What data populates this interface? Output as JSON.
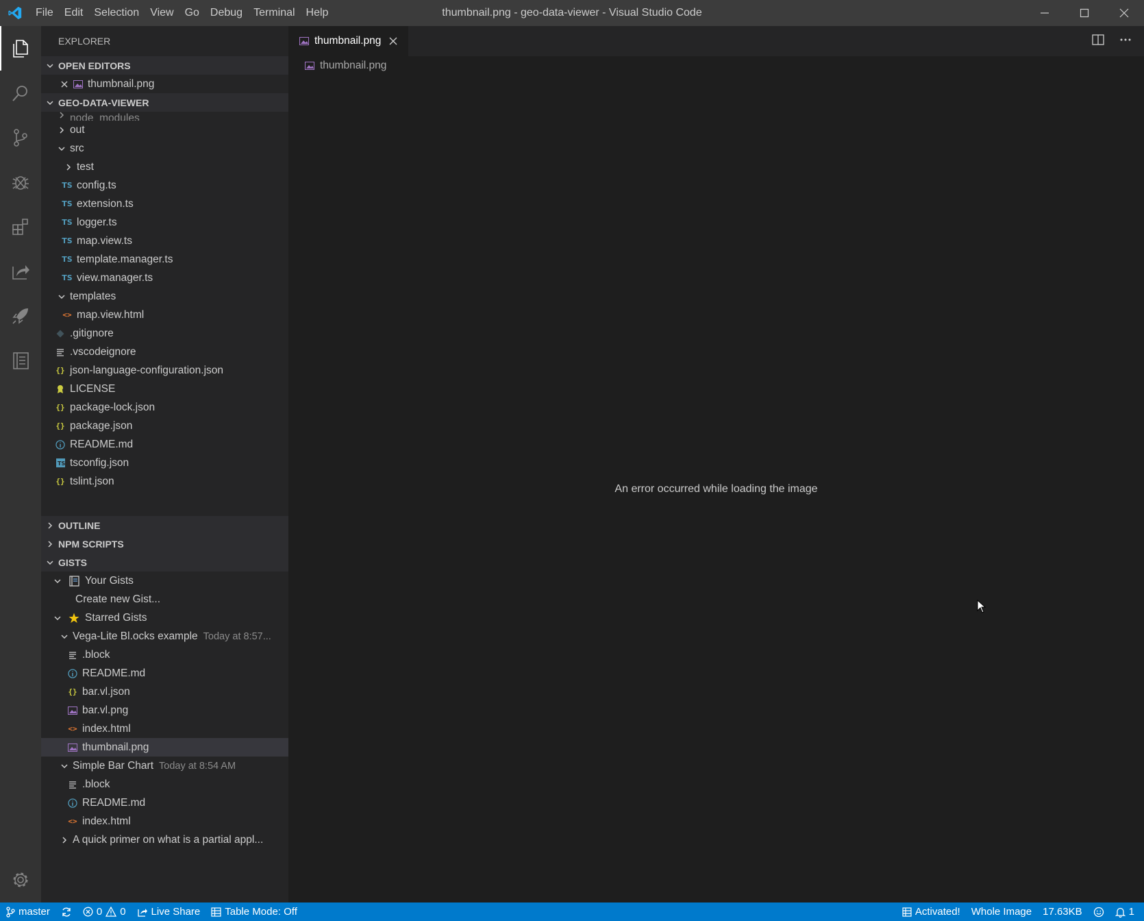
{
  "titlebar": {
    "menu": [
      "File",
      "Edit",
      "Selection",
      "View",
      "Go",
      "Debug",
      "Terminal",
      "Help"
    ],
    "window_title": "thumbnail.png - geo-data-viewer - Visual Studio Code"
  },
  "sidebar": {
    "title": "EXPLORER",
    "open_editors": {
      "label": "OPEN EDITORS",
      "items": [
        {
          "name": "thumbnail.png"
        }
      ]
    },
    "project": {
      "label": "GEO-DATA-VIEWER",
      "partial_item": "node_modules",
      "items": [
        {
          "name": "out",
          "kind": "folder",
          "expanded": false
        },
        {
          "name": "src",
          "kind": "folder",
          "expanded": true
        },
        {
          "name": "test",
          "kind": "folder",
          "expanded": false
        },
        {
          "name": "config.ts",
          "icon": "TS"
        },
        {
          "name": "extension.ts",
          "icon": "TS"
        },
        {
          "name": "logger.ts",
          "icon": "TS"
        },
        {
          "name": "map.view.ts",
          "icon": "TS"
        },
        {
          "name": "template.manager.ts",
          "icon": "TS"
        },
        {
          "name": "view.manager.ts",
          "icon": "TS"
        },
        {
          "name": "templates",
          "kind": "folder",
          "expanded": true
        },
        {
          "name": "map.view.html",
          "icon": "<>"
        },
        {
          "name": ".gitignore",
          "icon": "git-icon"
        },
        {
          "name": ".vscodeignore",
          "icon": "lines-icon"
        },
        {
          "name": "json-language-configuration.json",
          "icon": "{}"
        },
        {
          "name": "LICENSE",
          "icon": "license-icon"
        },
        {
          "name": "package-lock.json",
          "icon": "{}"
        },
        {
          "name": "package.json",
          "icon": "{}"
        },
        {
          "name": "README.md",
          "icon": "info-icon"
        },
        {
          "name": "tsconfig.json",
          "icon": "TS"
        },
        {
          "name": "tslint.json",
          "icon": "{}"
        }
      ]
    },
    "outline_label": "OUTLINE",
    "npm_label": "NPM SCRIPTS",
    "gists": {
      "label": "GISTS",
      "your_gists": "Your Gists",
      "create_new": "Create new Gist...",
      "starred": "Starred Gists",
      "vega": {
        "name": "Vega-Lite Bl.ocks example",
        "time": "Today at 8:57...",
        "files": [
          ".block",
          "README.md",
          "bar.vl.json",
          "bar.vl.png",
          "index.html",
          "thumbnail.png"
        ]
      },
      "simple": {
        "name": "Simple Bar Chart",
        "time": "Today at 8:54 AM",
        "files": [
          ".block",
          "README.md",
          "index.html"
        ]
      },
      "primer": "A quick primer on what is a partial appl..."
    }
  },
  "editor": {
    "tab_label": "thumbnail.png",
    "breadcrumb": "thumbnail.png",
    "error": "An error occurred while loading the image"
  },
  "statusbar": {
    "branch": "master",
    "errors": "0",
    "warnings": "0",
    "live_share": "Live Share",
    "table_mode": "Table Mode: Off",
    "activated": "Activated!",
    "whole_image": "Whole Image",
    "size": "17.63KB",
    "notifications": "1"
  },
  "colors": {
    "accent": "#007acc",
    "ts": "#519aba",
    "json": "#cbcb41",
    "html": "#e37933",
    "image": "#a074c4"
  }
}
